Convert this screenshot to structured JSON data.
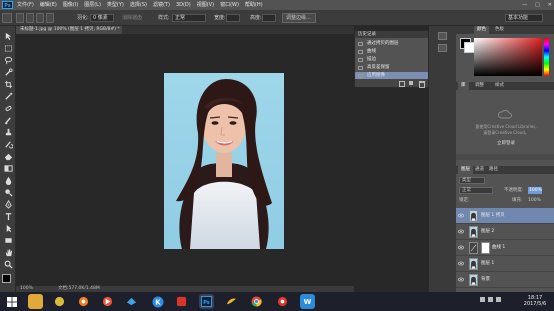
{
  "app": {
    "logo": "Ps"
  },
  "menu": [
    "文件(F)",
    "编辑(E)",
    "图像(I)",
    "图层(L)",
    "类型(Y)",
    "选择(S)",
    "滤镜(T)",
    "3D(D)",
    "视图(V)",
    "窗口(W)",
    "帮助(H)"
  ],
  "window_controls": [
    "—",
    "□",
    "✕"
  ],
  "options": {
    "feather_label": "羽化:",
    "feather_value": "0 像素",
    "antialias": "消除锯齿",
    "style_label": "样式:",
    "style_value": "正常",
    "width_label": "宽度:",
    "height_label": "高度:",
    "refine_button": "调整边缘...",
    "workspace": "基本功能"
  },
  "document_tab": "未标题-1.jpg @ 100% (图层 1 拷贝, RGB/8#) *",
  "statusbar": {
    "zoom": "100%",
    "doc": "文档:577.0K/1.48M"
  },
  "history": {
    "title": "历史记录",
    "items": [
      {
        "label": "通过拷贝的图层",
        "selected": false
      },
      {
        "label": "曲线",
        "selected": false
      },
      {
        "label": "描边",
        "selected": false
      },
      {
        "label": "高反差保留",
        "selected": false
      },
      {
        "label": "应用图像",
        "selected": true
      }
    ]
  },
  "libraries": {
    "tabs": [
      "颜色",
      "色板"
    ],
    "cc_text": "要使用Creative Cloud Libraries,",
    "cc_text2": "请登录Creative Cloud。",
    "cc_button": "立即登录"
  },
  "adjust_tabs": [
    "库",
    "调整",
    "样式"
  ],
  "layers": {
    "tabs": [
      "图层",
      "通道",
      "路径"
    ],
    "kind": "类型",
    "blend_mode": "正常",
    "opacity_label": "不透明度:",
    "opacity_value": "100%",
    "lock_label": "锁定:",
    "fill_label": "填充:",
    "fill_value": "100%",
    "rows": [
      {
        "name": "图层 1 拷贝",
        "selected": true,
        "type": "photo"
      },
      {
        "name": "图层 2",
        "selected": false,
        "type": "photo"
      },
      {
        "name": "曲线 1",
        "selected": false,
        "type": "adjust"
      },
      {
        "name": "图层 1",
        "selected": false,
        "type": "photo"
      },
      {
        "name": "背景",
        "selected": false,
        "type": "photo"
      }
    ]
  },
  "taskbar": {
    "time": "18:17",
    "date": "2017/5/6",
    "apps": [
      "W"
    ]
  }
}
